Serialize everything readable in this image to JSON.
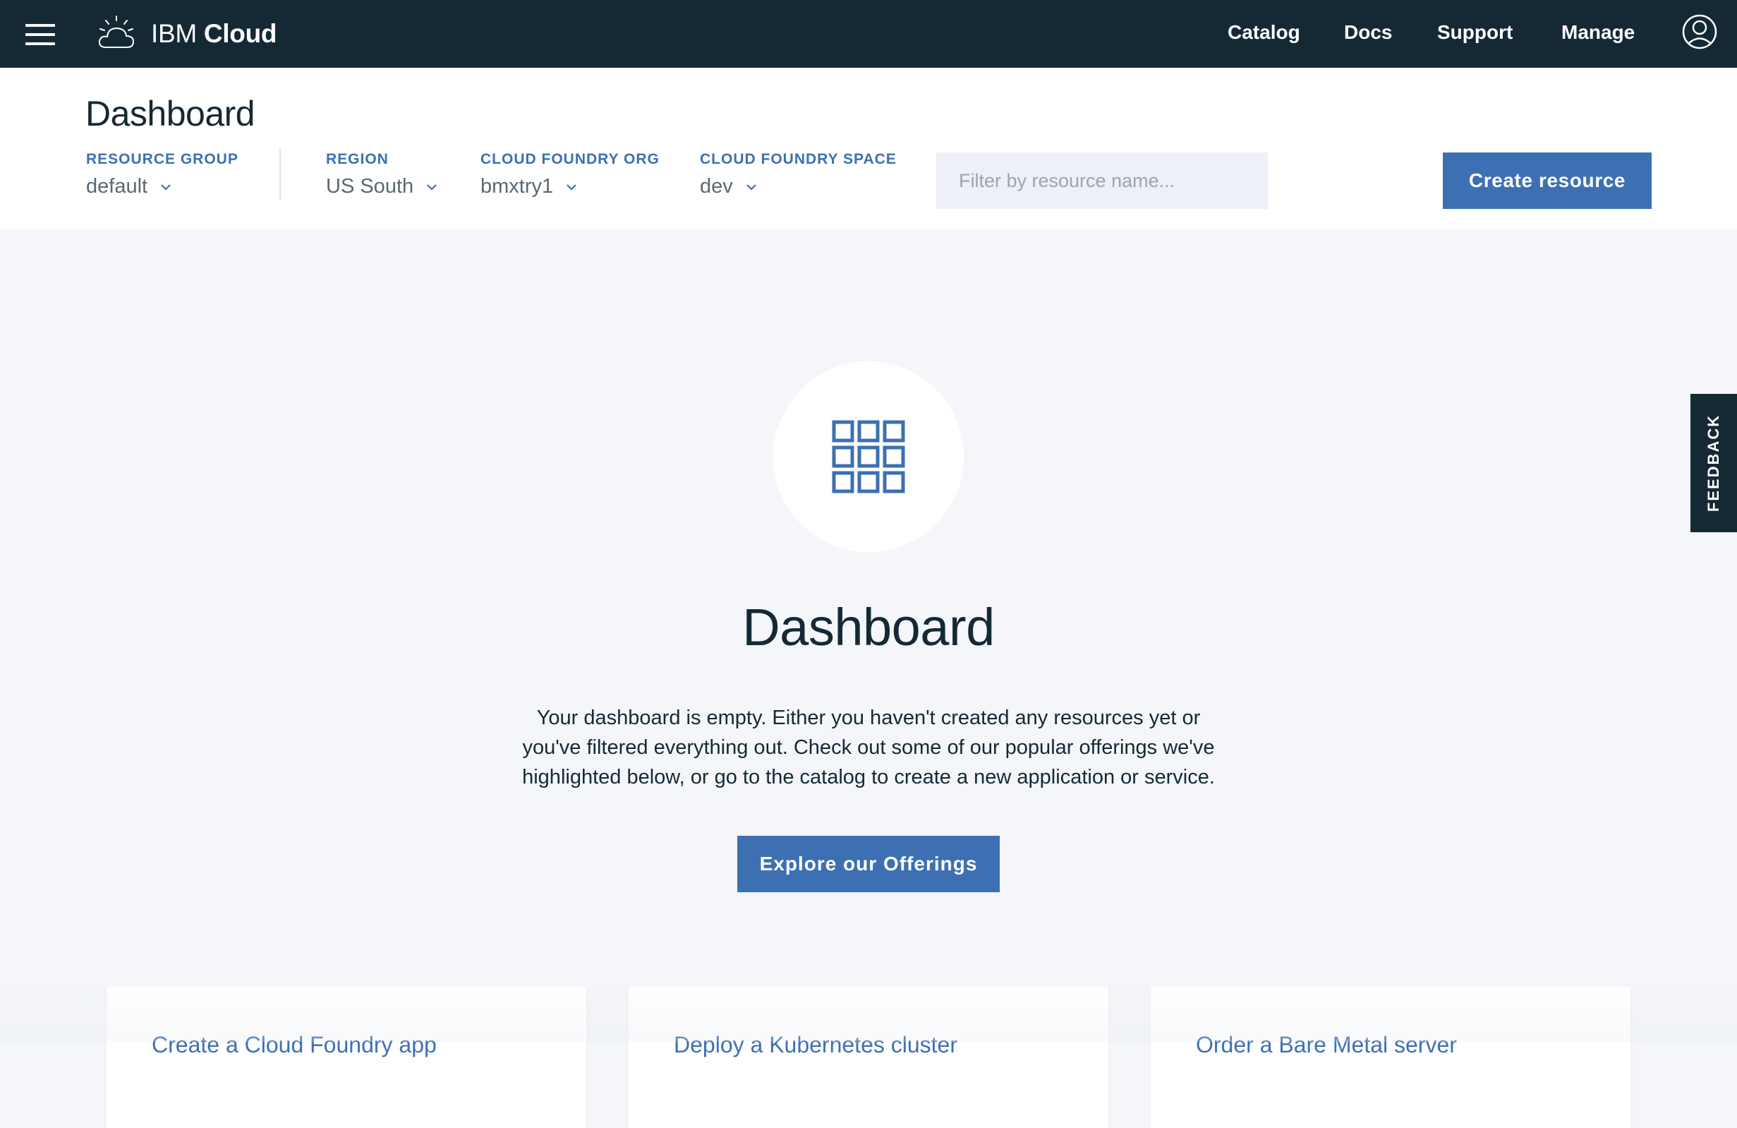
{
  "nav": {
    "brand_ibm": "IBM",
    "brand_cloud": "Cloud",
    "links": {
      "catalog": "Catalog",
      "docs": "Docs",
      "support": "Support",
      "manage": "Manage"
    }
  },
  "header": {
    "title": "Dashboard",
    "filters": {
      "resource_group": {
        "label": "RESOURCE GROUP",
        "value": "default"
      },
      "region": {
        "label": "REGION",
        "value": "US South"
      },
      "org": {
        "label": "CLOUD FOUNDRY ORG",
        "value": "bmxtry1"
      },
      "space": {
        "label": "CLOUD FOUNDRY SPACE",
        "value": "dev"
      }
    },
    "search_placeholder": "Filter by resource name...",
    "create_button": "Create resource"
  },
  "empty_state": {
    "icon": "grid-icon",
    "title": "Dashboard",
    "description": "Your dashboard is empty. Either you haven't created any resources yet or you've filtered everything out. Check out some of our popular offerings we've highlighted below, or go to the catalog to create a new application or service.",
    "button": "Explore our Offerings"
  },
  "feedback": "FEEDBACK",
  "cards": [
    {
      "title": "Create a Cloud Foundry app"
    },
    {
      "title": "Deploy a Kubernetes cluster"
    },
    {
      "title": "Order a Bare Metal server"
    }
  ],
  "colors": {
    "nav_bg": "#152935",
    "accent": "#3d70b2",
    "page_bg": "#f4f6f9",
    "search_bg": "#edf0f7"
  }
}
